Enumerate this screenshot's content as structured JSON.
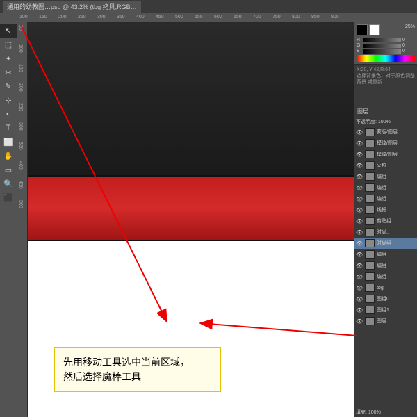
{
  "tab_title": "通用的幼教图…psd @ 43.2% (tbg 拷贝,RGB…",
  "ruler_h": [
    "100",
    "150",
    "200",
    "250",
    "300",
    "350",
    "400",
    "450",
    "500",
    "550",
    "600",
    "650",
    "700",
    "750",
    "800",
    "850",
    "900"
  ],
  "ruler_v": [
    "50",
    "100",
    "150",
    "200",
    "250",
    "300",
    "350",
    "400",
    "450",
    "500"
  ],
  "tools": [
    "↖",
    "⬚",
    "✦",
    "✂",
    "✎",
    "⊹",
    "◐",
    "T",
    "⬜",
    "✋",
    "▭",
    "🔍",
    "⬛"
  ],
  "panels": {
    "color": {
      "r": "0",
      "g": "0",
      "b": "0",
      "pct": "25%"
    },
    "info_line1": "X:20, Y:42,R:64",
    "info_line2": "选择背景色，对于原色调整",
    "info_line3": "背景 或重新",
    "layers_title": "图层",
    "opacity_label": "不透明度",
    "opacity_val": "100%",
    "fill_label": "填充",
    "fill_val": "100%",
    "layers": [
      {
        "n": "蒙版/图层"
      },
      {
        "n": "模纹/图层"
      },
      {
        "n": "模纹/图层"
      },
      {
        "n": "火粒"
      },
      {
        "n": "编组"
      },
      {
        "n": "编组"
      },
      {
        "n": "编组"
      },
      {
        "n": "线框"
      },
      {
        "n": "剪贴组"
      },
      {
        "n": "时尚.."
      },
      {
        "n": "时尚组",
        "sel": true
      },
      {
        "n": "编组"
      },
      {
        "n": "编组"
      },
      {
        "n": "编组"
      },
      {
        "n": "tbg"
      },
      {
        "n": "图组0"
      },
      {
        "n": "图组1"
      },
      {
        "n": "图层"
      }
    ]
  },
  "callout_l1": "先用移动工具选中当前区域，",
  "callout_l2": "然后选择魔棒工具"
}
